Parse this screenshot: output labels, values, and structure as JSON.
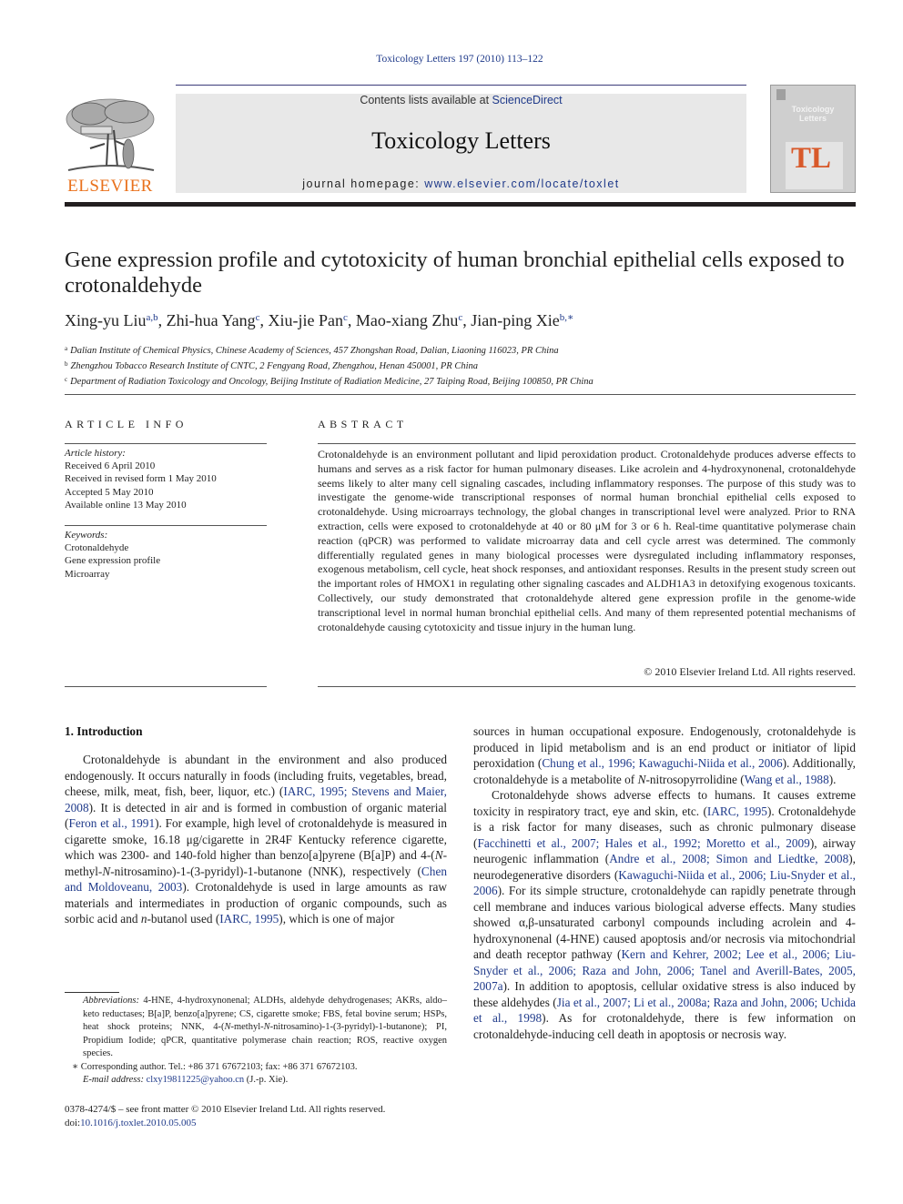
{
  "header": {
    "journal_ref": "Toxicology Letters 197 (2010) 113–122",
    "contents_prefix": "Contents lists available at ",
    "contents_link": "ScienceDirect",
    "journal_title": "Toxicology Letters",
    "homepage_prefix": "journal homepage: ",
    "homepage_url": "www.elsevier.com/locate/toxlet",
    "publisher_logo_text": "ELSEVIER",
    "cover_title_line1": "Toxicology",
    "cover_title_line2": "Letters",
    "cover_monogram": "TL",
    "colors": {
      "link": "#1f3a8a",
      "elsevier_orange": "#e9711c",
      "cover_tl": "#d8592a",
      "masthead_bg": "#e8e8e8"
    }
  },
  "article": {
    "title": "Gene expression profile and cytotoxicity of human bronchial epithelial cells exposed to crotonaldehyde",
    "authors": [
      {
        "name": "Xing-yu Liu",
        "sup": "a,b",
        "sep": ", "
      },
      {
        "name": "Zhi-hua Yang",
        "sup": "c",
        "sep": ", "
      },
      {
        "name": "Xiu-jie Pan",
        "sup": "c",
        "sep": ", "
      },
      {
        "name": "Mao-xiang Zhu",
        "sup": "c",
        "sep": ", "
      },
      {
        "name": "Jian-ping Xie",
        "sup": "b,∗",
        "sep": ""
      }
    ],
    "affiliations": [
      {
        "key": "a",
        "text": "Dalian Institute of Chemical Physics, Chinese Academy of Sciences, 457 Zhongshan Road, Dalian, Liaoning 116023, PR China"
      },
      {
        "key": "b",
        "text": "Zhengzhou Tobacco Research Institute of CNTC, 2 Fengyang Road, Zhengzhou, Henan 450001, PR China"
      },
      {
        "key": "c",
        "text": "Department of Radiation Toxicology and Oncology, Beijing Institute of Radiation Medicine, 27 Taiping Road, Beijing 100850, PR China"
      }
    ]
  },
  "article_info": {
    "heading": "ARTICLE INFO",
    "history_label": "Article history:",
    "history": [
      "Received 6 April 2010",
      "Received in revised form 1 May 2010",
      "Accepted 5 May 2010",
      "Available online 13 May 2010"
    ],
    "keywords_label": "Keywords:",
    "keywords": [
      "Crotonaldehyde",
      "Gene expression profile",
      "Microarray"
    ]
  },
  "abstract": {
    "heading": "ABSTRACT",
    "text": "Crotonaldehyde is an environment pollutant and lipid peroxidation product. Crotonaldehyde produces adverse effects to humans and serves as a risk factor for human pulmonary diseases. Like acrolein and 4-hydroxynonenal, crotonaldehyde seems likely to alter many cell signaling cascades, including inflammatory responses. The purpose of this study was to investigate the genome-wide transcriptional responses of normal human bronchial epithelial cells exposed to crotonaldehyde. Using microarrays technology, the global changes in transcriptional level were analyzed. Prior to RNA extraction, cells were exposed to crotonaldehyde at 40 or 80 μM for 3 or 6 h. Real-time quantitative polymerase chain reaction (qPCR) was performed to validate microarray data and cell cycle arrest was determined. The commonly differentially regulated genes in many biological processes were dysregulated including inflammatory responses, exogenous metabolism, cell cycle, heat shock responses, and antioxidant responses. Results in the present study screen out the important roles of HMOX1 in regulating other signaling cascades and ALDH1A3 in detoxifying exogenous toxicants. Collectively, our study demonstrated that crotonaldehyde altered gene expression profile in the genome-wide transcriptional level in normal human bronchial epithelial cells. And many of them represented potential mechanisms of crotonaldehyde causing cytotoxicity and tissue injury in the human lung.",
    "copyright": "© 2010 Elsevier Ireland Ltd. All rights reserved."
  },
  "body": {
    "section_heading": "1.  Introduction",
    "left_column": [
      {
        "t": "Crotonaldehyde is abundant in the environment and also produced endogenously. It occurs naturally in foods (including fruits, vegetables, bread, cheese, milk, meat, fish, beer, liquor, etc.) ("
      },
      {
        "l": "IARC, 1995; Stevens and Maier, 2008"
      },
      {
        "t": "). It is detected in air and is formed in combustion of organic material ("
      },
      {
        "l": "Feron et al., 1991"
      },
      {
        "t": "). For example, high level of crotonaldehyde is measured in cigarette smoke, 16.18 μg/cigarette in 2R4F Kentucky reference cigarette, which was 2300- and 140-fold higher than benzo[a]pyrene (B[a]P) and 4-("
      },
      {
        "i": "N"
      },
      {
        "t": "-methyl-"
      },
      {
        "i": "N"
      },
      {
        "t": "-nitrosamino)-1-(3-pyridyl)-1-butanone (NNK), respectively ("
      },
      {
        "l": "Chen and Moldoveanu, 2003"
      },
      {
        "t": "). Crotonaldehyde is used in large amounts as raw materials and intermediates in production of organic compounds, such as sorbic acid and "
      },
      {
        "i": "n"
      },
      {
        "t": "-butanol used ("
      },
      {
        "l": "IARC, 1995"
      },
      {
        "t": "), which is one of major"
      }
    ],
    "right_column_p1": [
      {
        "t": "sources in human occupational exposure. Endogenously, crotonaldehyde is produced in lipid metabolism and is an end product or initiator of lipid peroxidation ("
      },
      {
        "l": "Chung et al., 1996; Kawaguchi-Niida et al., 2006"
      },
      {
        "t": "). Additionally, crotonaldehyde is a metabolite of "
      },
      {
        "i": "N"
      },
      {
        "t": "-nitrosopyrrolidine ("
      },
      {
        "l": "Wang et al., 1988"
      },
      {
        "t": ")."
      }
    ],
    "right_column_p2": [
      {
        "t": "Crotonaldehyde shows adverse effects to humans. It causes extreme toxicity in respiratory tract, eye and skin, etc. ("
      },
      {
        "l": "IARC, 1995"
      },
      {
        "t": "). Crotonaldehyde is a risk factor for many diseases, such as chronic pulmonary disease ("
      },
      {
        "l": "Facchinetti et al., 2007; Hales et al., 1992; Moretto et al., 2009"
      },
      {
        "t": "), airway neurogenic inflammation ("
      },
      {
        "l": "Andre et al., 2008; Simon and Liedtke, 2008"
      },
      {
        "t": "), neurodegenerative disorders ("
      },
      {
        "l": "Kawaguchi-Niida et al., 2006; Liu-Snyder et al., 2006"
      },
      {
        "t": "). For its simple structure, crotonaldehyde can rapidly penetrate through cell membrane and induces various biological adverse effects. Many studies showed α,β-unsaturated carbonyl compounds including acrolein and 4-hydroxynonenal (4-HNE) caused apoptosis and/or necrosis via mitochondrial and death receptor pathway ("
      },
      {
        "l": "Kern and Kehrer, 2002; Lee et al., 2006; Liu-Snyder et al., 2006; Raza and John, 2006; Tanel and Averill-Bates, 2005, 2007a"
      },
      {
        "t": "). In addition to apoptosis, cellular oxidative stress is also induced by these aldehydes ("
      },
      {
        "l": "Jia et al., 2007; Li et al., 2008a; Raza and John, 2006; Uchida et al., 1998"
      },
      {
        "t": "). As for crotonaldehyde, there is few information on crotonaldehyde-inducing cell death in apoptosis or necrosis way."
      }
    ]
  },
  "footnotes": {
    "abbreviations_label": "Abbreviations:",
    "abbreviations": [
      {
        "t": "  4-HNE, 4-hydroxynonenal; ALDHs, aldehyde dehydrogenases; AKRs, aldo–keto reductases; B[a]P, benzo[a]pyrene; CS, cigarette smoke; FBS, fetal bovine serum; HSPs, heat shock proteins; NNK, 4-("
      },
      {
        "i": "N"
      },
      {
        "t": "-methyl-"
      },
      {
        "i": "N"
      },
      {
        "t": "-nitrosamino)-1-(3-pyridyl)-1-butanone); PI, Propidium Iodide; qPCR, quantitative polymerase chain reaction; ROS, reactive oxygen species."
      }
    ],
    "corresponding": "∗ Corresponding author. Tel.: +86 371 67672103; fax: +86 371 67672103.",
    "email_label": "E-mail address:",
    "email": "clxy19811225@yahoo.cn",
    "email_suffix": " (J.-p. Xie).",
    "issn_line": "0378-4274/$ – see front matter © 2010 Elsevier Ireland Ltd. All rights reserved.",
    "doi_prefix": "doi:",
    "doi": "10.1016/j.toxlet.2010.05.005"
  }
}
